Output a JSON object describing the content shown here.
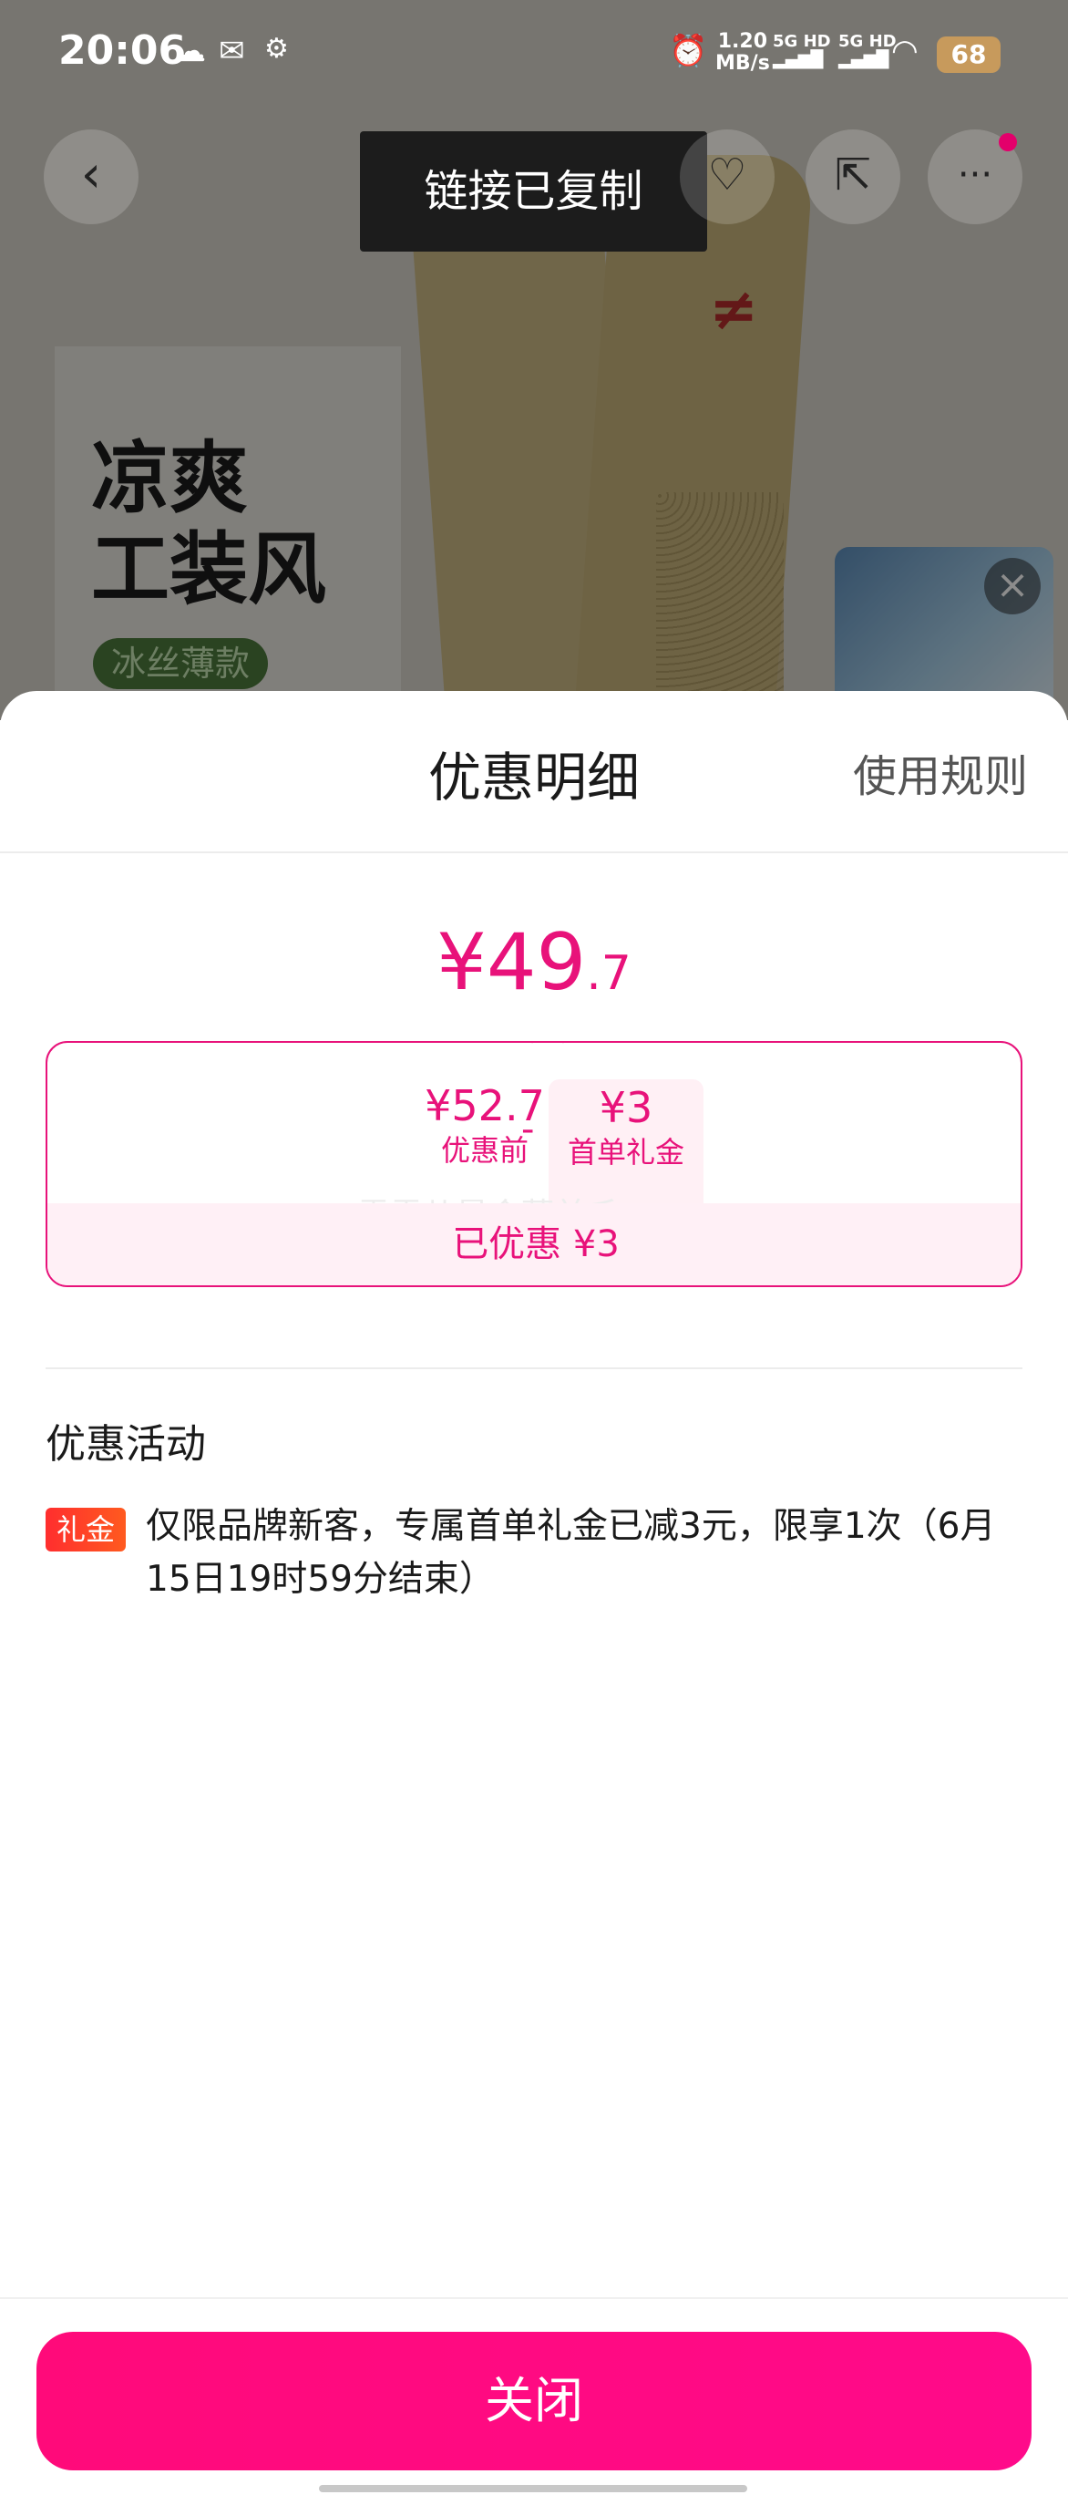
{
  "status_bar": {
    "time": "20:06",
    "net_speed_value": "1.20",
    "net_speed_unit": "MB/s",
    "sim1": "5G HD",
    "sim2": "5G HD",
    "battery": "68"
  },
  "background": {
    "promo_title_line1": "凉爽",
    "promo_title_line2": "工装风",
    "promo_tag": "冰丝薄款",
    "toast": "链接已复制"
  },
  "sheet": {
    "title": "优惠明细",
    "rules_link": "使用规则",
    "final_price_symbol": "¥",
    "final_price_int": "49",
    "final_price_dec": ".7",
    "before_value": "¥52.7",
    "before_label": "优惠前",
    "minus": "-",
    "gift_value": "¥3",
    "gift_label": "首单礼金",
    "watermark": "雪雪儿最会薅羊毛",
    "saved": "已优惠 ¥3",
    "section_label": "优惠活动",
    "gift_tag": "礼金",
    "activity_text": "仅限品牌新客，专属首单礼金已减3元，限享1次（6月15日19时59分结束）",
    "close_button": "关闭"
  },
  "colors": {
    "accent": "#e8127a",
    "close_button": "#ff0a7a",
    "gift_tag": "#ff2e2e"
  },
  "icons": [
    "back-icon",
    "favorite-add-icon",
    "share-icon",
    "more-icon",
    "close-icon"
  ]
}
